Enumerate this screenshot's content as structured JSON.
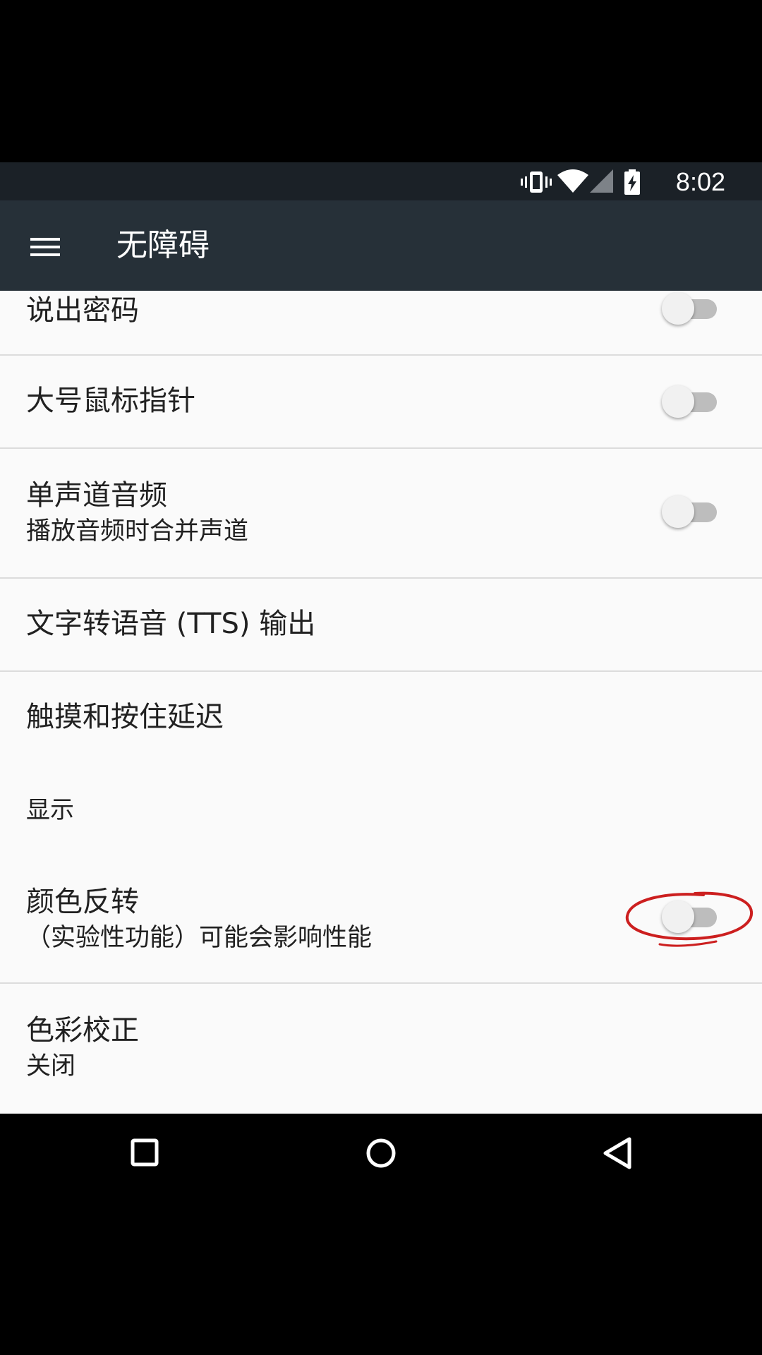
{
  "status_bar": {
    "time": "8:02",
    "icons": [
      "vibrate-icon",
      "wifi-icon",
      "signal-icon",
      "battery-charging-icon"
    ]
  },
  "toolbar": {
    "menu_icon": "menu-icon",
    "title": "无障碍"
  },
  "settings": [
    {
      "title": "说出密码",
      "summary": "",
      "switch": false
    },
    {
      "title": "大号鼠标指针",
      "summary": "",
      "switch": false
    },
    {
      "title": "单声道音频",
      "summary": "播放音频时合并声道",
      "switch": false
    },
    {
      "title": "文字转语音 (TTS) 输出",
      "summary": ""
    },
    {
      "title": "触摸和按住延迟",
      "summary": ""
    }
  ],
  "display_category": {
    "label": "显示",
    "items": [
      {
        "title": "颜色反转",
        "summary": "（实验性功能）可能会影响性能",
        "switch": false,
        "annotated": true
      },
      {
        "title": "色彩校正",
        "summary": "关闭"
      }
    ]
  },
  "colors": {
    "status_bar": "#1b2127",
    "toolbar": "#263038",
    "background": "#fafafa",
    "annotation": "#cc1f1f"
  },
  "nav_bar": {
    "icons": [
      "recents-icon",
      "home-icon",
      "back-icon"
    ]
  }
}
